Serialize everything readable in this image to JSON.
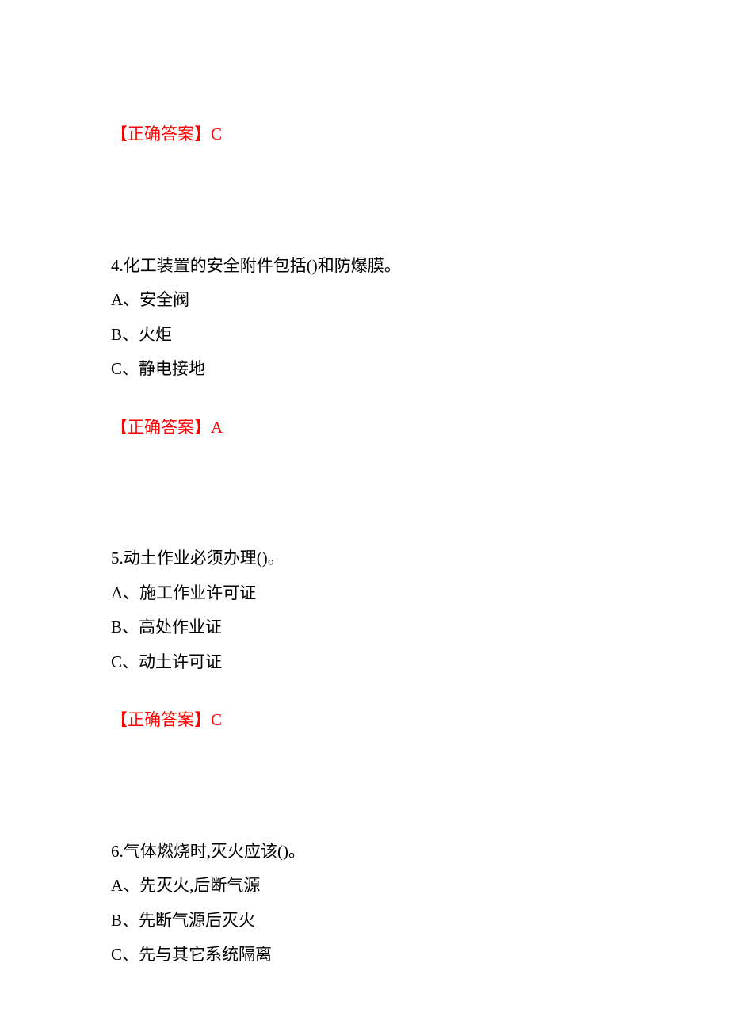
{
  "answer3": {
    "label": "【正确答案】",
    "letter": "C"
  },
  "q4": {
    "number": "4.",
    "text": "化工装置的安全附件包括()和防爆膜。",
    "options": {
      "A": "A、安全阀",
      "B": "B、火炬",
      "C": "C、静电接地"
    },
    "answer": {
      "label": "【正确答案】",
      "letter": "A"
    }
  },
  "q5": {
    "number": "5.",
    "text": "动土作业必须办理()。",
    "options": {
      "A": "A、施工作业许可证",
      "B": "B、高处作业证",
      "C": "C、动土许可证"
    },
    "answer": {
      "label": "【正确答案】",
      "letter": "C"
    }
  },
  "q6": {
    "number": "6.",
    "text": "气体燃烧时,灭火应该()。",
    "options": {
      "A": "A、先灭火,后断气源",
      "B": "B、先断气源后灭火",
      "C": "C、先与其它系统隔离"
    }
  }
}
